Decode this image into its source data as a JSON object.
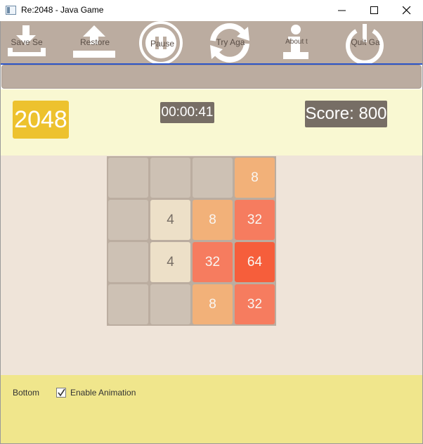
{
  "window": {
    "title": "Re:2048 - Java Game",
    "controls": [
      "minimize",
      "maximize",
      "close"
    ]
  },
  "toolbar": {
    "items": [
      {
        "label": "Save Se",
        "icon": "save-download-icon"
      },
      {
        "label": "Restore",
        "icon": "upload-icon"
      },
      {
        "label": "Pause",
        "icon": "pause-icon"
      },
      {
        "label": "Try Aga",
        "icon": "refresh-icon"
      },
      {
        "label": "About t",
        "icon": "info-icon"
      },
      {
        "label": "Quit Ga",
        "icon": "power-icon"
      }
    ]
  },
  "header": {
    "logo": "2048",
    "timer": "00:00:41",
    "score": "Score: 800"
  },
  "board": {
    "size": 4,
    "rows": [
      [
        "",
        "",
        "",
        "8"
      ],
      [
        "",
        "4",
        "8",
        "32"
      ],
      [
        "",
        "4",
        "32",
        "64"
      ],
      [
        "",
        "",
        "8",
        "32"
      ]
    ],
    "colors": {
      "empty": "#cdc1b4",
      "4": "#ede0c8",
      "8": "#f2b179",
      "32": "#f67c5f",
      "64": "#f65e3b",
      "board_bg": "#bbada0"
    }
  },
  "footer": {
    "label": "Bottom",
    "checkbox_label": "Enable Animation",
    "checkbox_checked": true
  }
}
